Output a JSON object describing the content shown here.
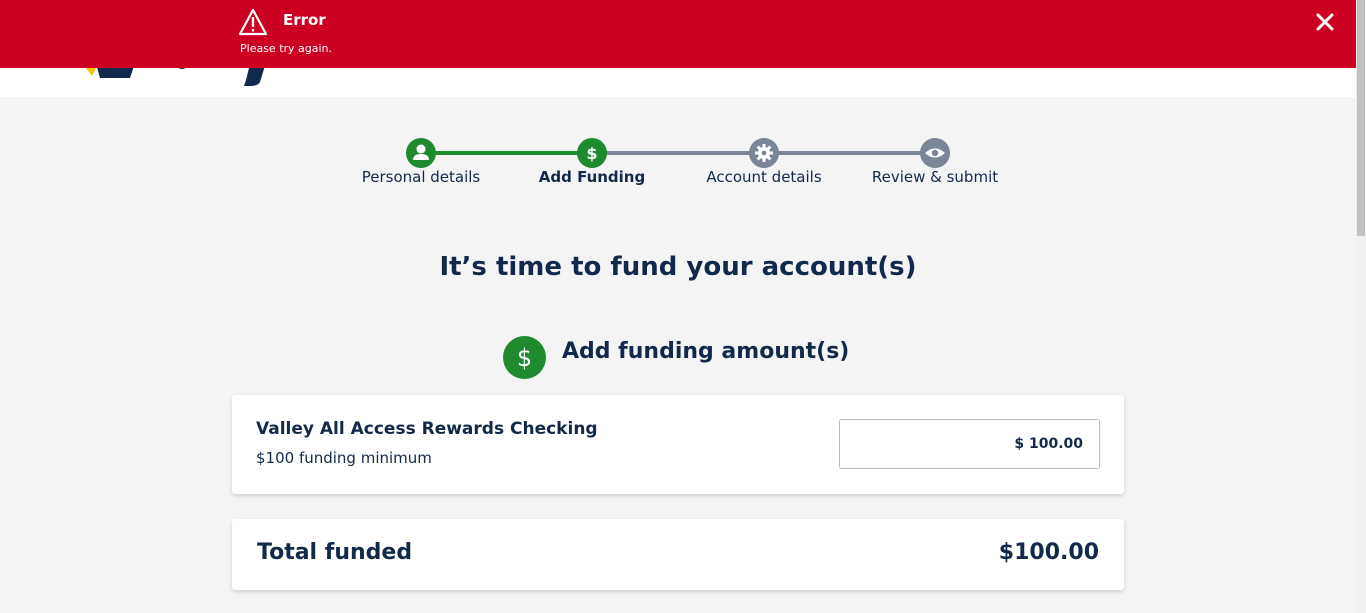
{
  "banner": {
    "title": "Error",
    "message": "Please try again.",
    "close_icon": "close-icon",
    "warning_icon": "warning-icon",
    "color": "#cc0022"
  },
  "stepper": {
    "steps": [
      {
        "label": "Personal details",
        "icon": "user-icon",
        "state": "complete"
      },
      {
        "label": "Add Funding",
        "icon": "dollar-icon",
        "state": "active"
      },
      {
        "label": "Account details",
        "icon": "gear-icon",
        "state": "upcoming"
      },
      {
        "label": "Review & submit",
        "icon": "eye-icon",
        "state": "upcoming"
      }
    ],
    "complete_color": "#1f8a2e",
    "upcoming_color": "#7a8595"
  },
  "main": {
    "title": "It’s time to fund your account(s)",
    "section_title": "Add funding amount(s)",
    "section_icon": "dollar-icon"
  },
  "product": {
    "name": "Valley All Access Rewards Checking",
    "minimum": "$100 funding minimum",
    "amount": "$ 100.00"
  },
  "total": {
    "label": "Total funded",
    "value": "$100.00"
  }
}
